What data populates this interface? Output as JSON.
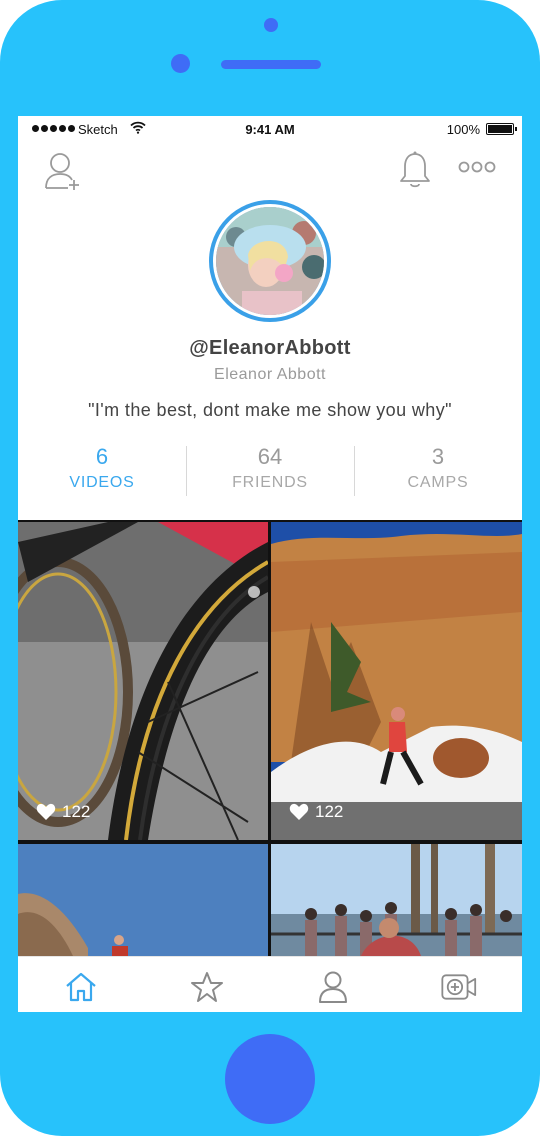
{
  "status": {
    "carrier": "Sketch",
    "time": "9:41 AM",
    "battery": "100%"
  },
  "header": {
    "left_icon": "add-user-icon",
    "bell_icon": "bell-icon",
    "more_icon": "more-icon"
  },
  "profile": {
    "username": "@EleanorAbbott",
    "full_name": "Eleanor Abbott",
    "bio": "\"I'm the best, dont make me show you why\""
  },
  "stats": [
    {
      "count": "6",
      "label": "VIDEOS",
      "active": true
    },
    {
      "count": "64",
      "label": "FRIENDS",
      "active": false
    },
    {
      "count": "3",
      "label": "CAMPS",
      "active": false
    }
  ],
  "videos": [
    {
      "likes": "122",
      "subject": "bicycle-wheel"
    },
    {
      "likes": "122",
      "subject": "runner-cliff"
    },
    {
      "subject": "rock-sky"
    },
    {
      "subject": "crowd-pier"
    }
  ],
  "tabbar": [
    "home-icon",
    "star-icon",
    "profile-icon",
    "video-add-icon"
  ],
  "colors": {
    "accent": "#3aa8ee",
    "phone_body": "#27c2fb",
    "phone_buttons": "#3f6cf6"
  }
}
